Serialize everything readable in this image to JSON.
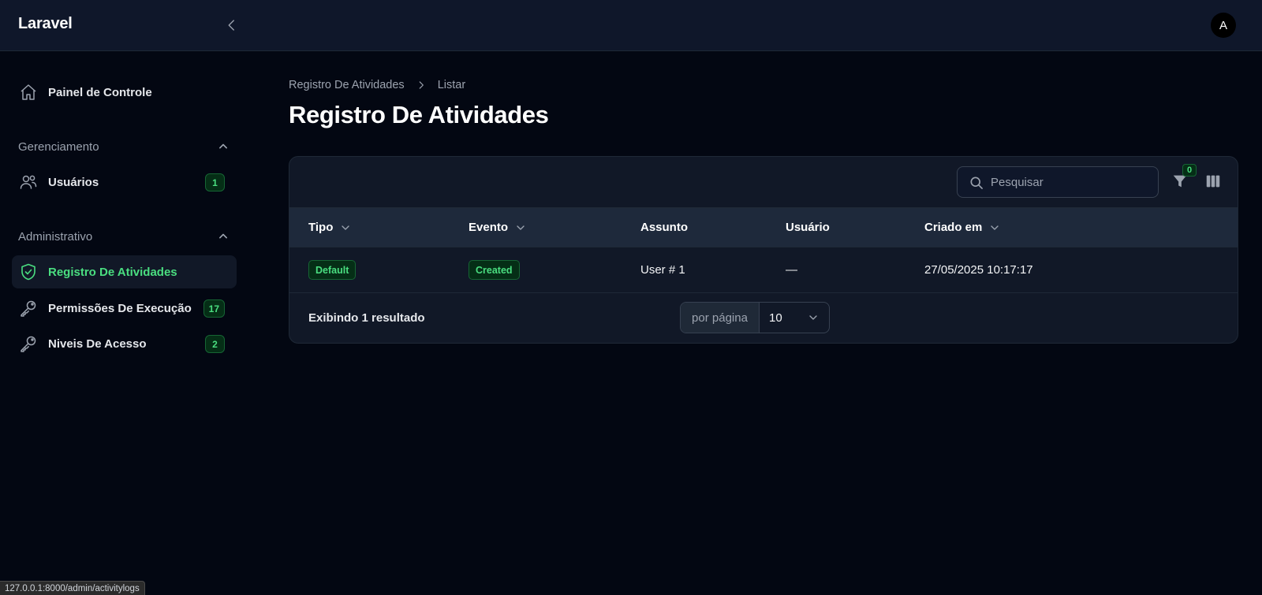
{
  "app": {
    "brand": "Laravel",
    "user_initial": "A"
  },
  "sidebar": {
    "dashboard": {
      "label": "Painel de Controle",
      "icon": "home-icon"
    },
    "groups": [
      {
        "label": "Gerenciamento",
        "items": [
          {
            "label": "Usuários",
            "icon": "users-icon",
            "badge": "1"
          }
        ]
      },
      {
        "label": "Administrativo",
        "items": [
          {
            "label": "Registro De Atividades",
            "icon": "shield-check-icon",
            "active": true
          },
          {
            "label": "Permissões De Execução",
            "icon": "key-icon",
            "badge": "17"
          },
          {
            "label": "Niveis De Acesso",
            "icon": "key-icon",
            "badge": "2"
          }
        ]
      }
    ]
  },
  "breadcrumb": {
    "parent": "Registro De Atividades",
    "current": "Listar"
  },
  "page": {
    "title": "Registro De Atividades"
  },
  "table": {
    "search_placeholder": "Pesquisar",
    "filter_count": "0",
    "columns": {
      "tipo": "Tipo",
      "evento": "Evento",
      "assunto": "Assunto",
      "usuario": "Usuário",
      "criado_em": "Criado em"
    },
    "rows": [
      {
        "tipo": "Default",
        "evento": "Created",
        "assunto": "User # 1",
        "usuario": "—",
        "criado_em": "27/05/2025 10:17:17"
      }
    ],
    "summary": "Exibindo 1 resultado",
    "per_page_label": "por página",
    "per_page_value": "10"
  },
  "status_url": "127.0.0.1:8000/admin/activitylogs",
  "colors": {
    "accent": "#4ade80",
    "background": "#030712",
    "panel": "#111827"
  }
}
